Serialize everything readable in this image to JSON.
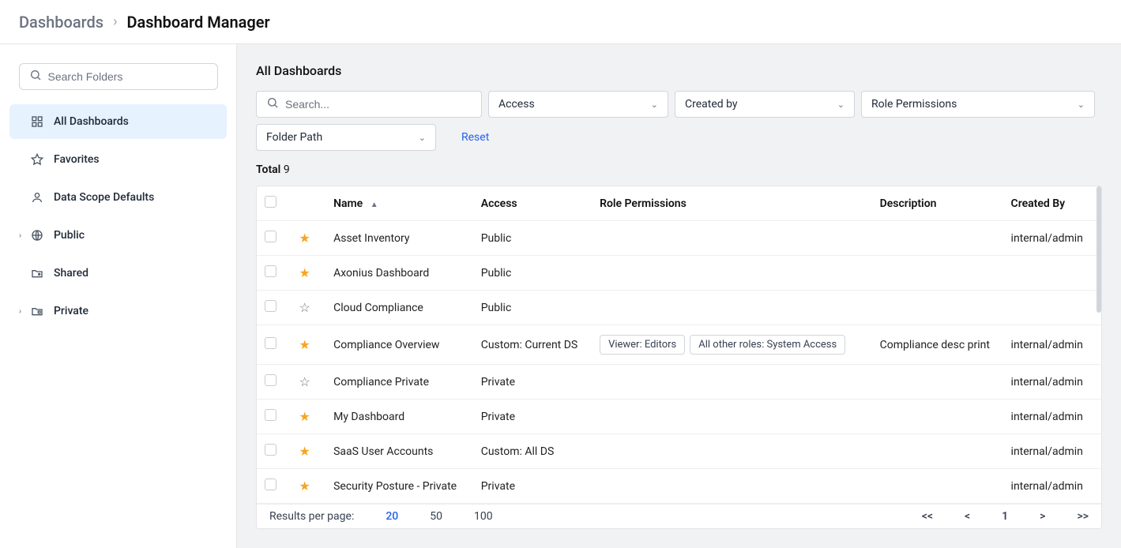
{
  "breadcrumb": {
    "root": "Dashboards",
    "current": "Dashboard Manager"
  },
  "sidebar": {
    "search_placeholder": "Search Folders",
    "items": [
      {
        "label": "All Dashboards",
        "icon": "dashboard",
        "active": true,
        "expandable": false
      },
      {
        "label": "Favorites",
        "icon": "star",
        "active": false,
        "expandable": false
      },
      {
        "label": "Data Scope Defaults",
        "icon": "person",
        "active": false,
        "expandable": false
      },
      {
        "label": "Public",
        "icon": "globe",
        "active": false,
        "expandable": true
      },
      {
        "label": "Shared",
        "icon": "folder-shared",
        "active": false,
        "expandable": false
      },
      {
        "label": "Private",
        "icon": "lock-folder",
        "active": false,
        "expandable": true
      }
    ]
  },
  "main": {
    "title": "All Dashboards",
    "search_placeholder": "Search...",
    "filters": {
      "access": "Access",
      "created_by": "Created by",
      "role_permissions": "Role Permissions",
      "folder_path": "Folder Path"
    },
    "reset": "Reset",
    "total_label": "Total",
    "total_value": "9",
    "columns": {
      "name": "Name",
      "access": "Access",
      "role_permissions": "Role Permissions",
      "description": "Description",
      "created_by": "Created By"
    },
    "rows": [
      {
        "name": "Asset Inventory",
        "access": "Public",
        "perms": [],
        "desc": "",
        "created_by": "internal/admin",
        "fav": true
      },
      {
        "name": "Axonius Dashboard",
        "access": "Public",
        "perms": [],
        "desc": "",
        "created_by": "",
        "fav": true
      },
      {
        "name": "Cloud Compliance",
        "access": "Public",
        "perms": [],
        "desc": "",
        "created_by": "",
        "fav": false
      },
      {
        "name": "Compliance Overview",
        "access": "Custom: Current DS",
        "perms": [
          "Viewer: Editors",
          "All other roles: System Access"
        ],
        "desc": "Compliance desc print",
        "created_by": "internal/admin",
        "fav": true
      },
      {
        "name": "Compliance Private",
        "access": "Private",
        "perms": [],
        "desc": "",
        "created_by": "internal/admin",
        "fav": false
      },
      {
        "name": "My Dashboard",
        "access": "Private",
        "perms": [],
        "desc": "",
        "created_by": "internal/admin",
        "fav": true
      },
      {
        "name": "SaaS User Accounts",
        "access": "Custom: All DS",
        "perms": [],
        "desc": "",
        "created_by": "internal/admin",
        "fav": true
      },
      {
        "name": "Security Posture - Private",
        "access": "Private",
        "perms": [],
        "desc": "",
        "created_by": "internal/admin",
        "fav": true
      }
    ],
    "pagination": {
      "label": "Results per page:",
      "options": [
        "20",
        "50",
        "100"
      ],
      "active": "20",
      "first": "<<",
      "prev": "<",
      "page": "1",
      "next": ">",
      "last": ">>"
    }
  }
}
